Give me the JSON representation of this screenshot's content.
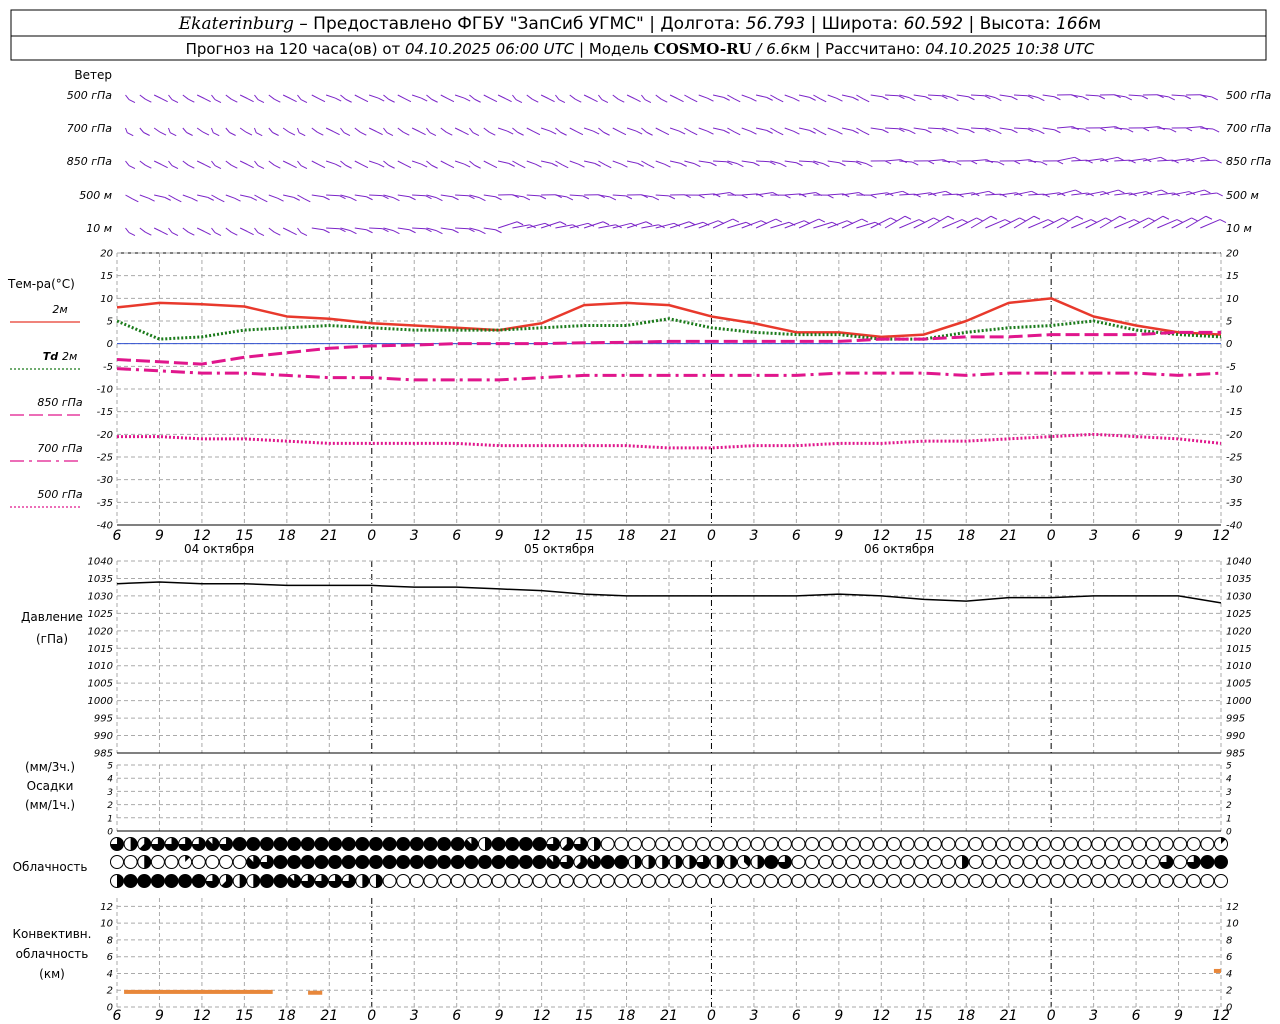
{
  "header": {
    "line1": {
      "station": "Ekaterinburg",
      "provider_text": " – Предоставлено ФГБУ \"ЗапСиб УГМС\" | Долгота: ",
      "longitude": "56.793",
      "lat_label": " | Широта: ",
      "latitude": "60.592",
      "alt_label": " | Высота: ",
      "altitude": "166",
      "alt_unit": "м"
    },
    "line2": {
      "forecast_text": "Прогноз на 120 часа(ов) от ",
      "start_time": "04.10.2025 06:00 UTC",
      "model_label": "  | Модель ",
      "model": "COSMO-RU",
      "resolution": " / 6.6",
      "res_unit": "км",
      "calc_label": " | Рассчитано: ",
      "calc_time": "04.10.2025 10:38 UTC"
    }
  },
  "wind_panel": {
    "title": "Ветер",
    "levels": [
      "500 гПа",
      "700 гПа",
      "850 гПа",
      "500 м",
      "10  м"
    ],
    "color": "#7b24c8"
  },
  "temp_panel": {
    "title": "Тем-ра(°С)",
    "legend": [
      {
        "label": "2м",
        "prefix": "",
        "color": "#e8392c",
        "dash": "solid"
      },
      {
        "label": "2м",
        "prefix": "Td",
        "color": "#1a7a1a",
        "dash": "dotted"
      },
      {
        "label": "850 гПа",
        "prefix": "",
        "color": "#e0168c",
        "dash": "long"
      },
      {
        "label": "700 гПа",
        "prefix": "",
        "color": "#e0168c",
        "dash": "dashdot"
      },
      {
        "label": "500 гПа",
        "prefix": "",
        "color": "#e0168c",
        "dash": "dotted"
      }
    ],
    "yticks": [
      "20",
      "15",
      "10",
      "5",
      "0",
      "-5",
      "-10",
      "-15",
      "-20",
      "-25",
      "-30",
      "-35",
      "-40"
    ]
  },
  "time_axis": {
    "ticks": [
      "6",
      "9",
      "12",
      "15",
      "18",
      "21",
      "0",
      "3",
      "6",
      "9",
      "12",
      "15",
      "18",
      "21",
      "0",
      "3",
      "6",
      "9",
      "12",
      "15",
      "18",
      "21",
      "0",
      "3",
      "6",
      "9",
      "12"
    ],
    "dates": [
      "04 октября",
      "05 октября",
      "06 октября"
    ]
  },
  "pressure_panel": {
    "label1": "Давление",
    "label2": "(гПа)",
    "yticks": [
      "1040",
      "1035",
      "1030",
      "1025",
      "1020",
      "1015",
      "1010",
      "1005",
      "1000",
      "995",
      "990",
      "985"
    ]
  },
  "precip_panel": {
    "label1": "(мм/3ч.)",
    "label2": "Осадки",
    "label3": "(мм/1ч.)",
    "yticks": [
      "5",
      "4",
      "3",
      "2",
      "1",
      "0"
    ]
  },
  "cloud_panel": {
    "label": "Облачность"
  },
  "conv_panel": {
    "label1": "Конвективн.",
    "label2": "облачность",
    "label3": "(км)",
    "yticks": [
      "12",
      "10",
      "8",
      "6",
      "4",
      "2",
      "0"
    ]
  },
  "chart_data": [
    {
      "type": "line",
      "name": "temperature",
      "x_hours": [
        0,
        3,
        6,
        9,
        12,
        15,
        18,
        21,
        24,
        27,
        30,
        33,
        36,
        39,
        42,
        45,
        48,
        51,
        54,
        57,
        60,
        63,
        66,
        69,
        72,
        75,
        78
      ],
      "ylim": [
        -40,
        20
      ],
      "series": [
        {
          "name": "2м",
          "values": [
            8,
            9,
            8.7,
            8.2,
            6,
            5.5,
            4.5,
            4,
            3.5,
            3,
            4.5,
            8.5,
            9,
            8.5,
            6,
            4.5,
            2.5,
            2.5,
            1.5,
            2,
            5,
            9,
            10,
            6,
            4,
            2.5,
            2
          ]
        },
        {
          "name": "Td 2м",
          "values": [
            5,
            1,
            1.5,
            3,
            3.5,
            4,
            3.5,
            3,
            3,
            3,
            3.5,
            4,
            4,
            5.5,
            3.5,
            2.5,
            2,
            2,
            1,
            1,
            2.5,
            3.5,
            4,
            5,
            3,
            2,
            1.5
          ]
        },
        {
          "name": "850 гПа",
          "values": [
            -3.5,
            -4,
            -4.5,
            -3,
            -2,
            -1,
            -0.5,
            -0.3,
            0,
            0,
            0,
            0.2,
            0.3,
            0.5,
            0.5,
            0.5,
            0.5,
            0.5,
            1,
            1,
            1.5,
            1.5,
            2,
            2,
            2,
            2.5,
            2.5
          ]
        },
        {
          "name": "700 гПа",
          "values": [
            -5.5,
            -6,
            -6.5,
            -6.5,
            -7,
            -7.5,
            -7.5,
            -8,
            -8,
            -8,
            -7.5,
            -7,
            -7,
            -7,
            -7,
            -7,
            -7,
            -6.5,
            -6.5,
            -6.5,
            -7,
            -6.5,
            -6.5,
            -6.5,
            -6.5,
            -7,
            -6.5
          ]
        },
        {
          "name": "500 гПа",
          "values": [
            -20.5,
            -20.5,
            -21,
            -21,
            -21.5,
            -22,
            -22,
            -22,
            -22,
            -22.5,
            -22.5,
            -22.5,
            -22.5,
            -23,
            -23,
            -22.5,
            -22.5,
            -22,
            -22,
            -21.5,
            -21.5,
            -21,
            -20.5,
            -20,
            -20.5,
            -21,
            -22
          ]
        }
      ]
    },
    {
      "type": "line",
      "name": "pressure",
      "ylim": [
        985,
        1040
      ],
      "series": [
        {
          "name": "Давление",
          "values": [
            1033.5,
            1034,
            1033.5,
            1033.5,
            1033,
            1033,
            1033,
            1032.5,
            1032.5,
            1032,
            1031.5,
            1030.5,
            1030,
            1030,
            1030,
            1030,
            1030,
            1030.5,
            1030,
            1029,
            1028.5,
            1029.5,
            1029.5,
            1030,
            1030,
            1030,
            1028
          ]
        }
      ]
    },
    {
      "type": "bar",
      "name": "precipitation",
      "ylim": [
        0,
        5
      ],
      "values": []
    },
    {
      "type": "table",
      "name": "cloudiness_octas",
      "rows": [
        [
          6,
          4,
          5,
          6,
          6,
          6,
          6,
          7,
          6,
          8,
          8,
          8,
          8,
          8,
          8,
          8,
          8,
          8,
          8,
          8,
          8,
          8,
          8,
          8,
          8,
          8,
          7,
          4,
          8,
          8,
          8,
          8,
          6,
          5,
          6,
          4,
          0,
          0,
          0,
          0,
          0,
          0,
          0,
          0,
          0,
          0,
          0,
          0,
          0,
          0,
          0,
          0,
          0,
          0,
          0,
          0,
          0,
          0,
          0,
          0,
          0,
          0,
          0,
          0,
          0,
          0,
          0,
          0,
          0,
          0,
          0,
          0,
          0,
          0,
          0,
          0,
          0,
          0,
          0,
          0,
          0,
          1
        ],
        [
          0,
          0,
          4,
          0,
          0,
          1,
          0,
          0,
          0,
          0,
          7,
          6,
          8,
          8,
          8,
          8,
          8,
          8,
          8,
          8,
          8,
          8,
          8,
          8,
          8,
          8,
          8,
          8,
          8,
          8,
          8,
          8,
          7,
          6,
          5,
          7,
          8,
          8,
          4,
          4,
          4,
          4,
          4,
          6,
          4,
          4,
          3,
          4,
          8,
          6,
          0,
          0,
          0,
          0,
          0,
          0,
          0,
          0,
          0,
          0,
          0,
          0,
          4,
          0,
          0,
          0,
          0,
          0,
          0,
          0,
          0,
          0,
          0,
          0,
          0,
          0,
          0,
          6,
          0,
          6,
          8,
          8
        ],
        [
          4,
          8,
          8,
          8,
          8,
          8,
          8,
          6,
          5,
          4,
          4,
          8,
          8,
          7,
          6,
          6,
          6,
          6,
          4,
          4,
          0,
          0,
          0,
          0,
          0,
          0,
          0,
          0,
          0,
          0,
          0,
          0,
          0,
          0,
          0,
          0,
          0,
          0,
          0,
          0,
          0,
          0,
          0,
          0,
          0,
          0,
          0,
          0,
          0,
          0,
          0,
          0,
          0,
          0,
          0,
          0,
          0,
          0,
          0,
          0,
          0,
          0,
          0,
          0,
          0,
          0,
          0,
          0,
          0,
          0,
          0,
          0,
          0,
          0,
          0,
          0,
          0,
          0,
          0,
          0,
          0,
          0
        ]
      ]
    },
    {
      "type": "bar",
      "name": "convective_cloud_top_km",
      "ylim": [
        0,
        13
      ],
      "segments": [
        {
          "from_h": 0.5,
          "to_h": 11,
          "value": 1.8
        },
        {
          "from_h": 13.5,
          "to_h": 14.5,
          "value": 1.7
        },
        {
          "from_h": 77.5,
          "to_h": 78,
          "value": 4.3
        }
      ]
    }
  ]
}
